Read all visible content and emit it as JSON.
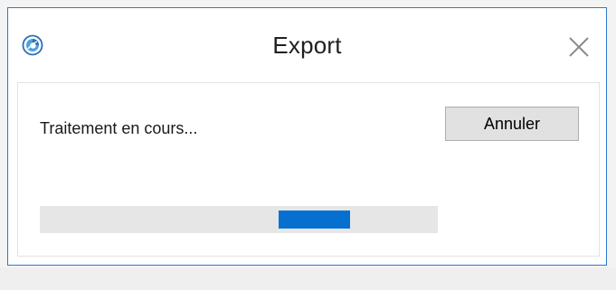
{
  "dialog": {
    "title": "Export",
    "status_text": "Traitement en cours...",
    "cancel_label": "Annuler"
  },
  "progress": {
    "mode": "indeterminate",
    "chunk_start_fraction": 0.6,
    "chunk_width_fraction": 0.18
  },
  "icons": {
    "app": "app-logo-icon",
    "close": "close-icon"
  },
  "colors": {
    "accent": "#0670d0",
    "window_border": "#2b79d0",
    "track": "#e6e6e6",
    "button_face": "#e1e1e1"
  }
}
